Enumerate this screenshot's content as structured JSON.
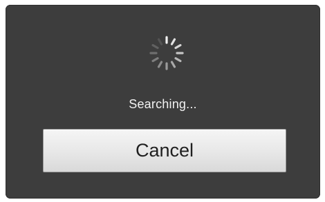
{
  "dialog": {
    "status_text": "Searching...",
    "cancel_label": "Cancel"
  },
  "icons": {
    "spinner": "loading-spinner-icon"
  },
  "colors": {
    "dialog_background": "#3d3d3d",
    "status_text": "#f2f2f2",
    "button_background": "#e7e7e7",
    "button_text": "#202020"
  }
}
